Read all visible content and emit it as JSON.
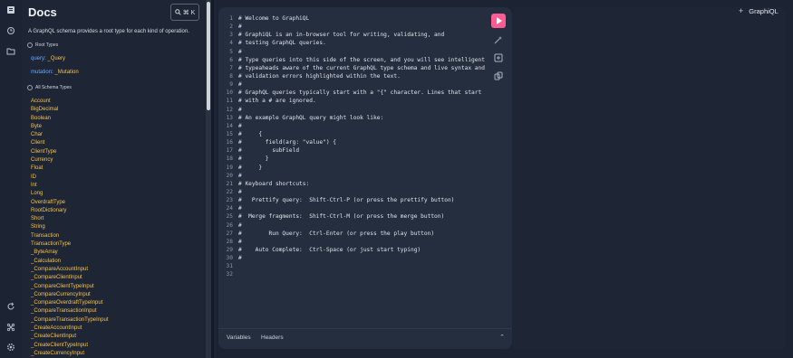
{
  "sidebar_rail": {
    "icons": [
      "docs-icon",
      "history-icon",
      "explorer-icon",
      "refresh-icon",
      "shortcuts-icon",
      "settings-icon"
    ]
  },
  "docs": {
    "title": "Docs",
    "search_shortcut": "⌘ K",
    "description": "A GraphQL schema provides a root type for each kind of operation.",
    "root_types_label": "Root Types",
    "root_types": [
      {
        "field": "query",
        "type": "_Query"
      },
      {
        "field": "mutation",
        "type": "_Mutation"
      }
    ],
    "all_schema_types_label": "All Schema Types",
    "types": [
      "Account",
      "BigDecimal",
      "Boolean",
      "Byte",
      "Char",
      "Client",
      "ClientType",
      "Currency",
      "Float",
      "ID",
      "Int",
      "Long",
      "OverdraftType",
      "RootDictionary",
      "Short",
      "String",
      "Transaction",
      "TransactionType",
      "_ByteArray",
      "_Calculation",
      "_CompareAccountInput",
      "_CompareClientInput",
      "_CompareClientTypeInput",
      "_CompareCurrencyInput",
      "_CompareOverdraftTypeInput",
      "_CompareTransactionInput",
      "_CompareTransactionTypeInput",
      "_CreateAccountInput",
      "_CreateClientInput",
      "_CreateClientTypeInput",
      "_CreateCurrencyInput"
    ]
  },
  "editor": {
    "lines": [
      "# Welcome to GraphiQL",
      "#",
      "# GraphiQL is an in-browser tool for writing, validating, and",
      "# testing GraphQL queries.",
      "#",
      "# Type queries into this side of the screen, and you will see intelligent",
      "# typeaheads aware of the current GraphQL type schema and live syntax and",
      "# validation errors highlighted within the text.",
      "#",
      "# GraphQL queries typically start with a \"{\" character. Lines that start",
      "# with a # are ignored.",
      "#",
      "# An example GraphQL query might look like:",
      "#",
      "#     {",
      "#       field(arg: \"value\") {",
      "#         subField",
      "#       }",
      "#     }",
      "#",
      "# Keyboard shortcuts:",
      "#",
      "#   Prettify query:  Shift-Ctrl-P (or press the prettify button)",
      "#",
      "#  Merge fragments:  Shift-Ctrl-M (or press the merge button)",
      "#",
      "#        Run Query:  Ctrl-Enter (or press the play button)",
      "#",
      "#    Auto Complete:  Ctrl-Space (or just start typing)",
      "#",
      "",
      ""
    ],
    "tabs": {
      "variables": "Variables",
      "headers": "Headers"
    }
  },
  "header": {
    "brand": "GraphiQL",
    "add_tab": "+"
  },
  "colors": {
    "accent": "#ff5c93",
    "field": "#6ea8ff",
    "type": "#f2c14e"
  }
}
